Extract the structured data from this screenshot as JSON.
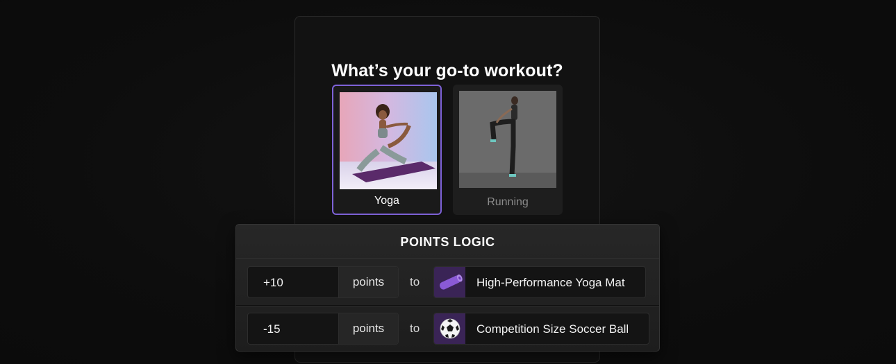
{
  "quiz": {
    "title": "What’s your go-to workout?",
    "options": [
      {
        "label": "Yoga",
        "selected": true
      },
      {
        "label": "Running",
        "selected": false
      }
    ]
  },
  "points_logic": {
    "title": "POINTS LOGIC",
    "rules": [
      {
        "points": "+10",
        "unit": "points",
        "connector": "to",
        "product": "High-Performance Yoga Mat",
        "icon": "yoga-mat-icon"
      },
      {
        "points": "-15",
        "unit": "points",
        "connector": "to",
        "product": "Competition Size Soccer Ball",
        "icon": "soccer-ball-icon"
      }
    ]
  },
  "colors": {
    "accent": "#7e62d8",
    "background": "#0e0e0e",
    "card": "#121212",
    "thumb": "#3a2456"
  }
}
